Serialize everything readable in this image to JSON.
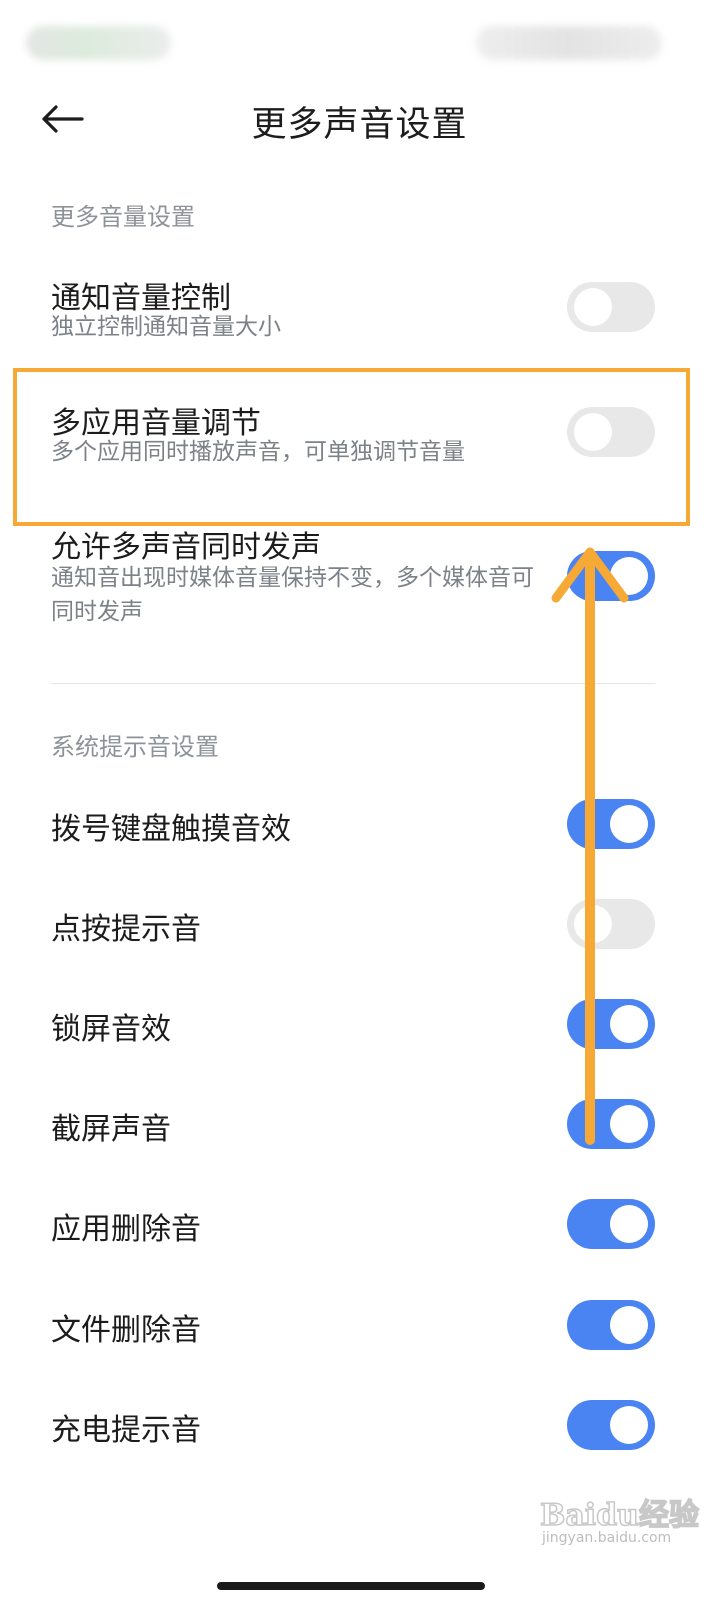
{
  "header": {
    "title": "更多声音设置",
    "back_icon": "arrow-left-icon"
  },
  "sections": [
    {
      "header": "更多音量设置",
      "items": [
        {
          "title": "通知音量控制",
          "subtitle": "独立控制通知音量大小",
          "enabled": false
        },
        {
          "title": "多应用音量调节",
          "subtitle": "多个应用同时播放声音，可单独调节音量",
          "enabled": false
        },
        {
          "title": "允许多声音同时发声",
          "subtitle": "通知音出现时媒体音量保持不变，多个媒体音可同时发声",
          "enabled": true
        }
      ]
    },
    {
      "header": "系统提示音设置",
      "items": [
        {
          "title": "拨号键盘触摸音效",
          "enabled": true
        },
        {
          "title": "点按提示音",
          "enabled": false
        },
        {
          "title": "锁屏音效",
          "enabled": true
        },
        {
          "title": "截屏声音",
          "enabled": true
        },
        {
          "title": "应用删除音",
          "enabled": true
        },
        {
          "title": "文件删除音",
          "enabled": true
        },
        {
          "title": "充电提示音",
          "enabled": true
        }
      ]
    }
  ],
  "annotation": {
    "highlight_color": "#f6a935",
    "arrow_color": "#f6a935"
  },
  "watermark": {
    "logo_text": "Baidu经验",
    "url": "jingyan.baidu.com"
  },
  "colors": {
    "toggle_on": "#4a84f2",
    "toggle_off": "#e8e8e8",
    "section_header": "#8e9399"
  }
}
